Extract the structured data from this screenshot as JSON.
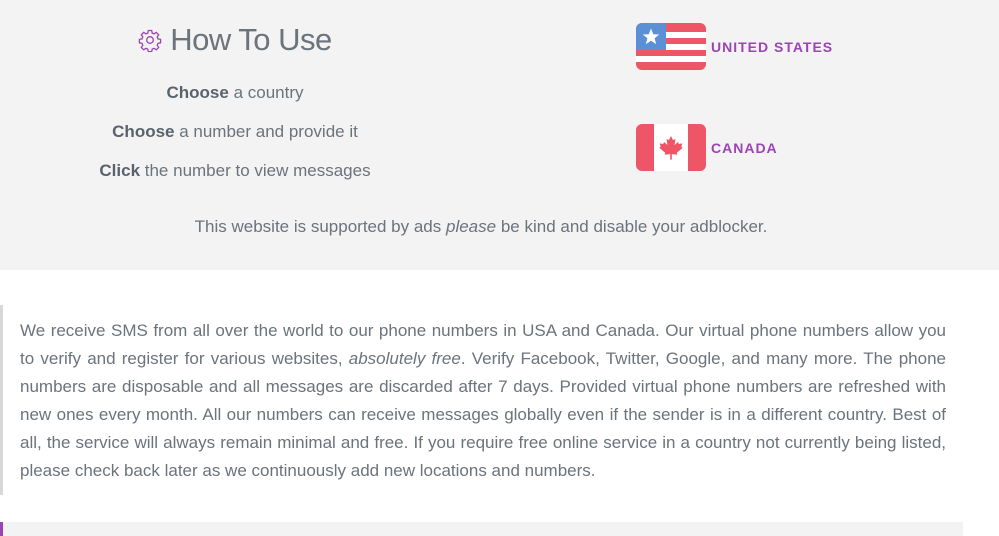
{
  "howto": {
    "title": "How To Use",
    "steps": [
      {
        "bold": "Choose",
        "rest": " a country"
      },
      {
        "bold": "Choose",
        "rest": " a number and provide it"
      },
      {
        "bold": "Click",
        "rest": " the number to view messages"
      }
    ]
  },
  "countries": [
    {
      "name": "UNITED STATES",
      "flag_icon": "us-flag-icon"
    },
    {
      "name": "CANADA",
      "flag_icon": "canada-flag-icon"
    }
  ],
  "adnote": {
    "before": "This website is supported by ads ",
    "emphasis": "please",
    "after": " be kind and disable your adblocker."
  },
  "about": {
    "part1": "We receive SMS from all over the world to our phone numbers in USA and Canada. Our virtual phone numbers allow you to verify and register for various websites, ",
    "emphasis": "absolutely free",
    "part2": ". Verify Facebook, Twitter, Google, and many more. The phone numbers are disposable and all messages are discarded after 7 days. Provided virtual phone numbers are refreshed with new ones every month. All our numbers can receive messages globally even if the sender is in a different country. Best of all, the service will always remain minimal and free. If you require free online service in a country not currently being listed, please check back later as we continuously add new locations and numbers."
  },
  "colors": {
    "accent": "#9b45b3",
    "flag_red": "#ee5566",
    "flag_blue": "#5b8fd6",
    "panel_bg": "#f3f3f4"
  }
}
